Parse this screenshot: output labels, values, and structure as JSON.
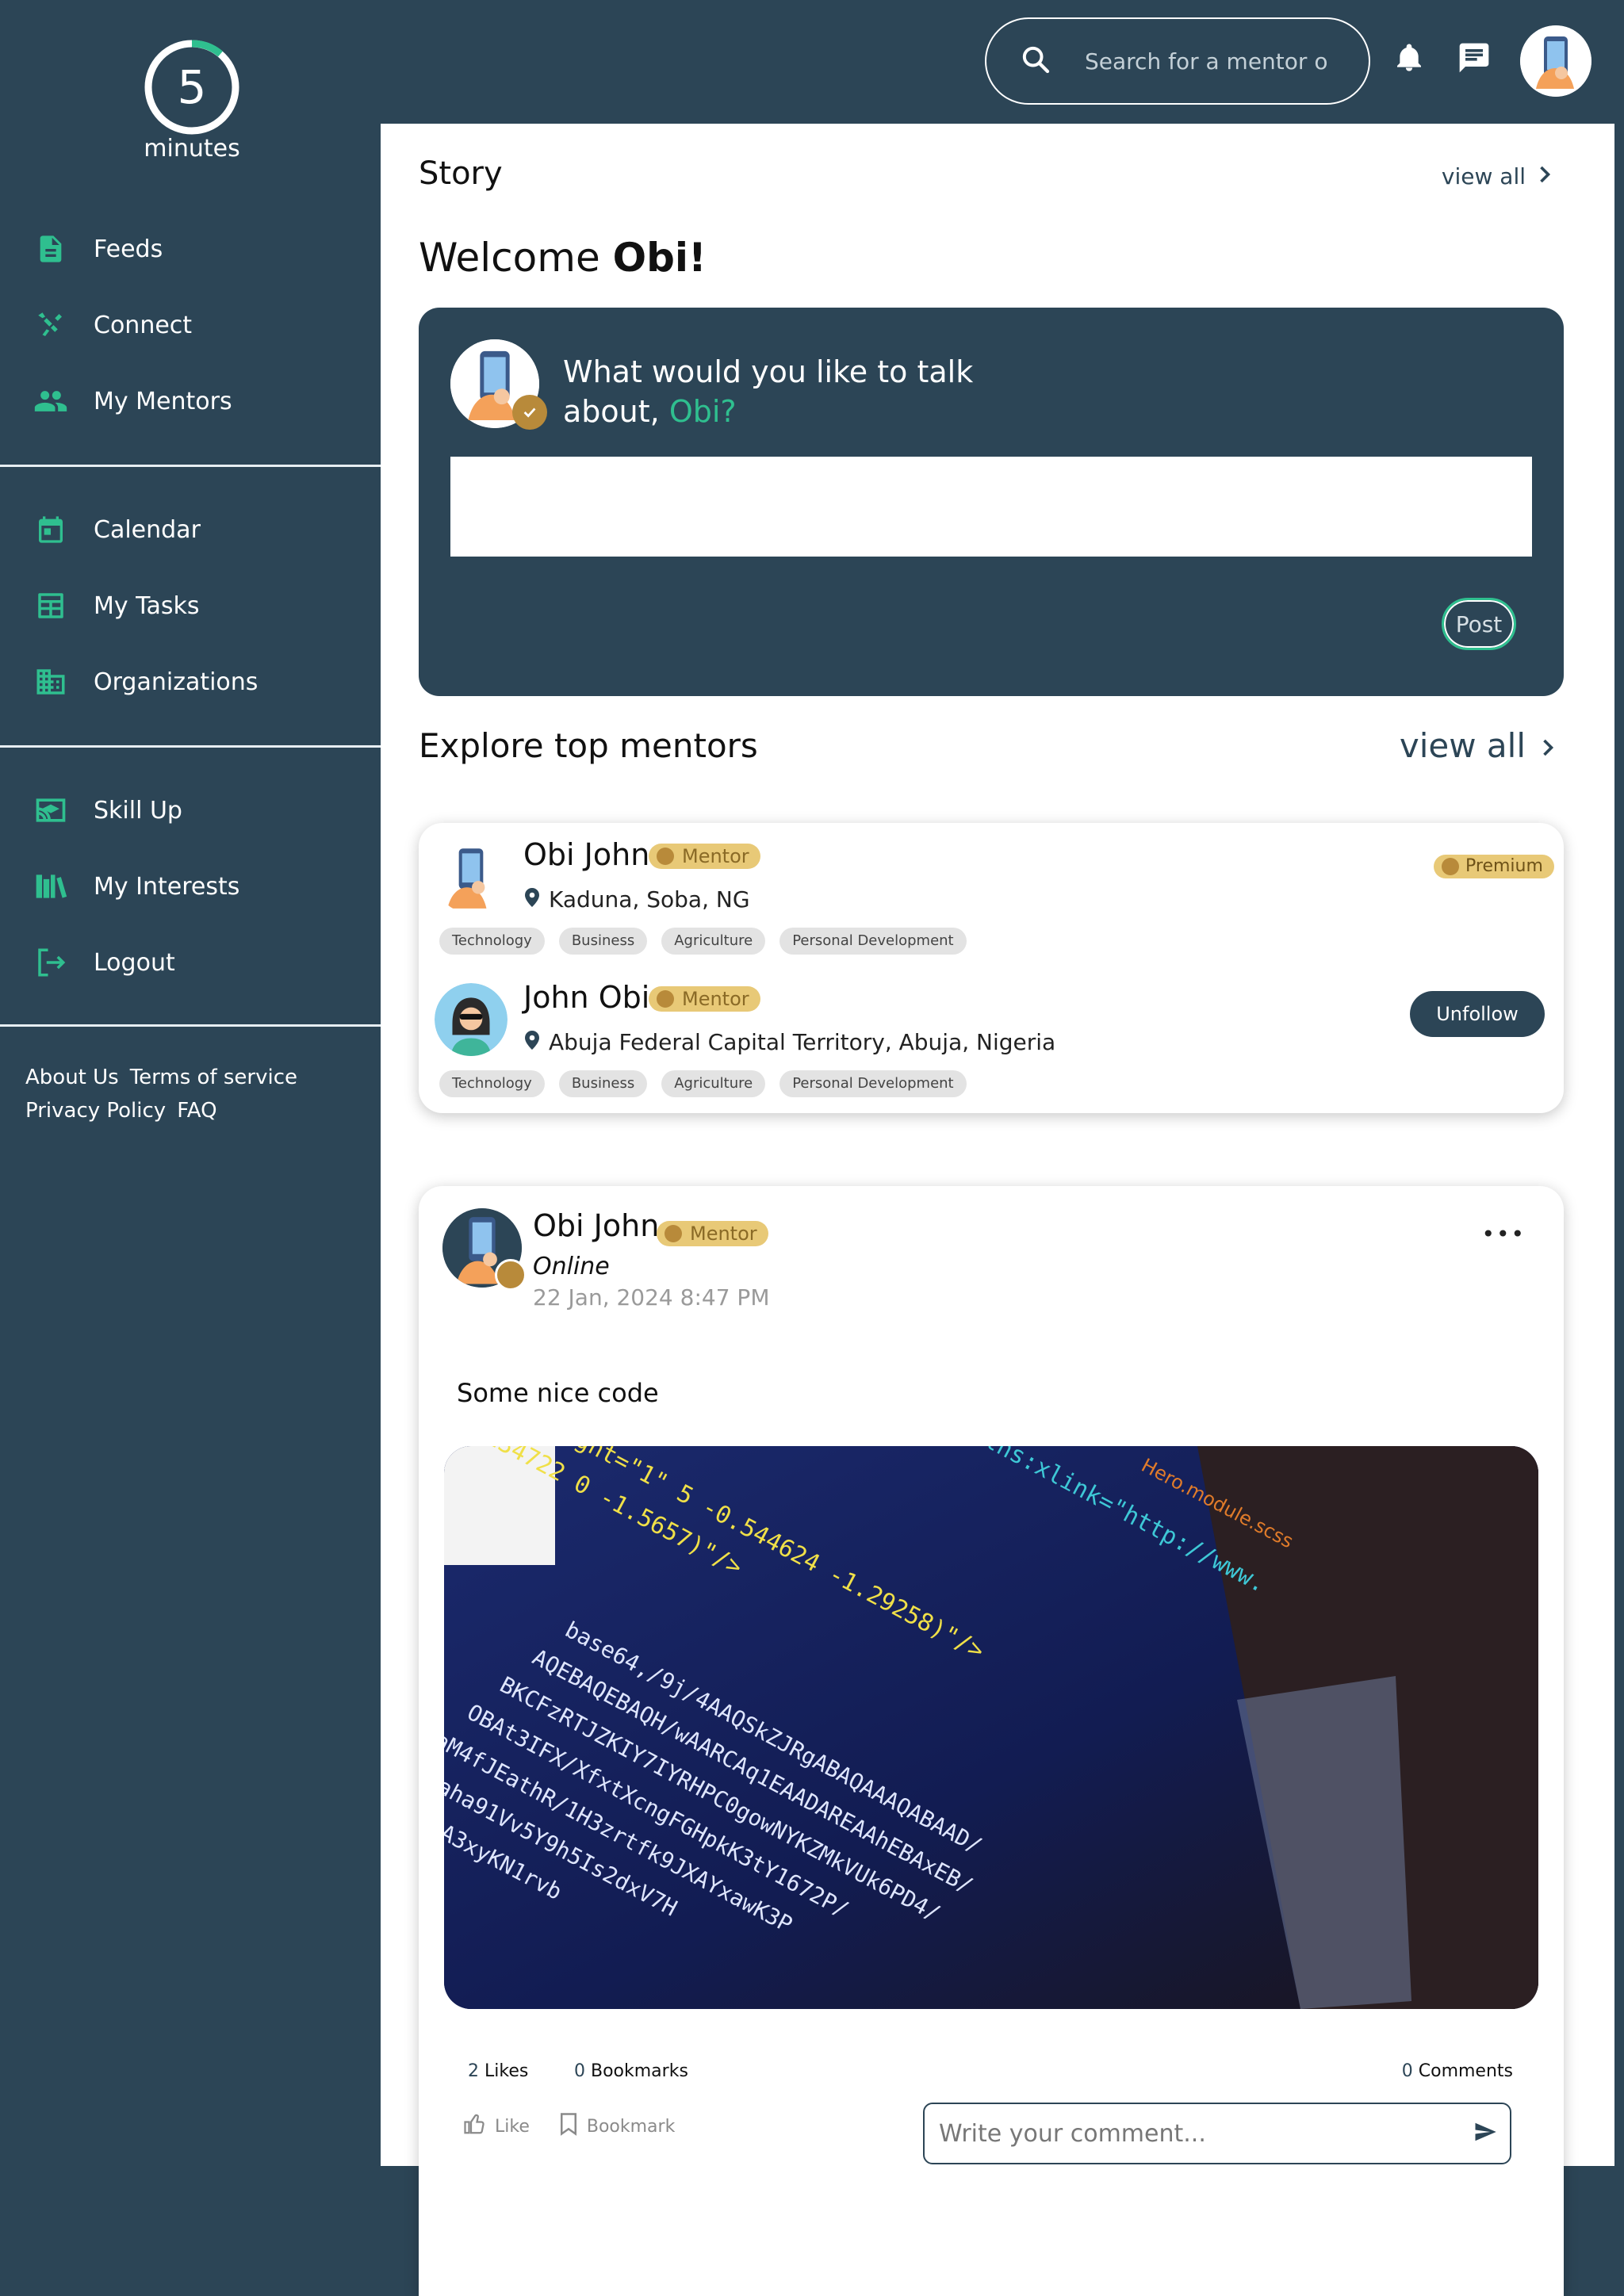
{
  "logo": {
    "number": "5",
    "word": "minutes"
  },
  "nav": {
    "group1": [
      {
        "label": "Feeds",
        "icon": "document-icon"
      },
      {
        "label": "Connect",
        "icon": "connect-icon"
      },
      {
        "label": "My Mentors",
        "icon": "people-icon"
      }
    ],
    "group2": [
      {
        "label": "Calendar",
        "icon": "calendar-icon"
      },
      {
        "label": "My Tasks",
        "icon": "tasks-icon"
      },
      {
        "label": "Organizations",
        "icon": "building-icon"
      }
    ],
    "group3": [
      {
        "label": "Skill Up",
        "icon": "graduation-icon"
      },
      {
        "label": "My Interests",
        "icon": "books-icon"
      },
      {
        "label": "Logout",
        "icon": "logout-icon"
      }
    ]
  },
  "footer": {
    "about": "About Us",
    "terms": "Terms of service",
    "privacy": "Privacy Policy",
    "faq": "FAQ"
  },
  "header": {
    "search_placeholder": "Search for a mentor o"
  },
  "story": {
    "title": "Story",
    "view_all": "view all"
  },
  "welcome": {
    "prefix": "Welcome",
    "name": "Obi!"
  },
  "composer": {
    "prompt": "What would you like to talk about,",
    "name": "Obi?",
    "post_label": "Post"
  },
  "explore": {
    "title": "Explore top mentors",
    "view_all": "view all"
  },
  "mentors": [
    {
      "name": "Obi John",
      "role": "Mentor",
      "location": "Kaduna, Soba, NG",
      "tags": [
        "Technology",
        "Business",
        "Agriculture",
        "Personal Development"
      ],
      "premium": "Premium"
    },
    {
      "name": "John Obi",
      "role": "Mentor",
      "location": "Abuja Federal Capital Territory, Abuja, Nigeria",
      "tags": [
        "Technology",
        "Business",
        "Agriculture",
        "Personal Development"
      ],
      "action": "Unfollow"
    }
  ],
  "post": {
    "author": "Obi John",
    "role": "Mentor",
    "status": "Online",
    "date": "22 Jan, 2024 8:47 PM",
    "more": "•••",
    "text": "Some nice code",
    "likes_count": "2",
    "likes_label": "Likes",
    "bookmarks_count": "0",
    "bookmarks_label": "Bookmarks",
    "comments_count": "0",
    "comments_label": "Comments",
    "like_action": "Like",
    "bookmark_action": "Bookmark",
    "comment_placeholder": "Write your comment..."
  },
  "colors": {
    "sidebar": "#2c4556",
    "accent": "#2fbf8f",
    "gold": "#e8c977"
  }
}
